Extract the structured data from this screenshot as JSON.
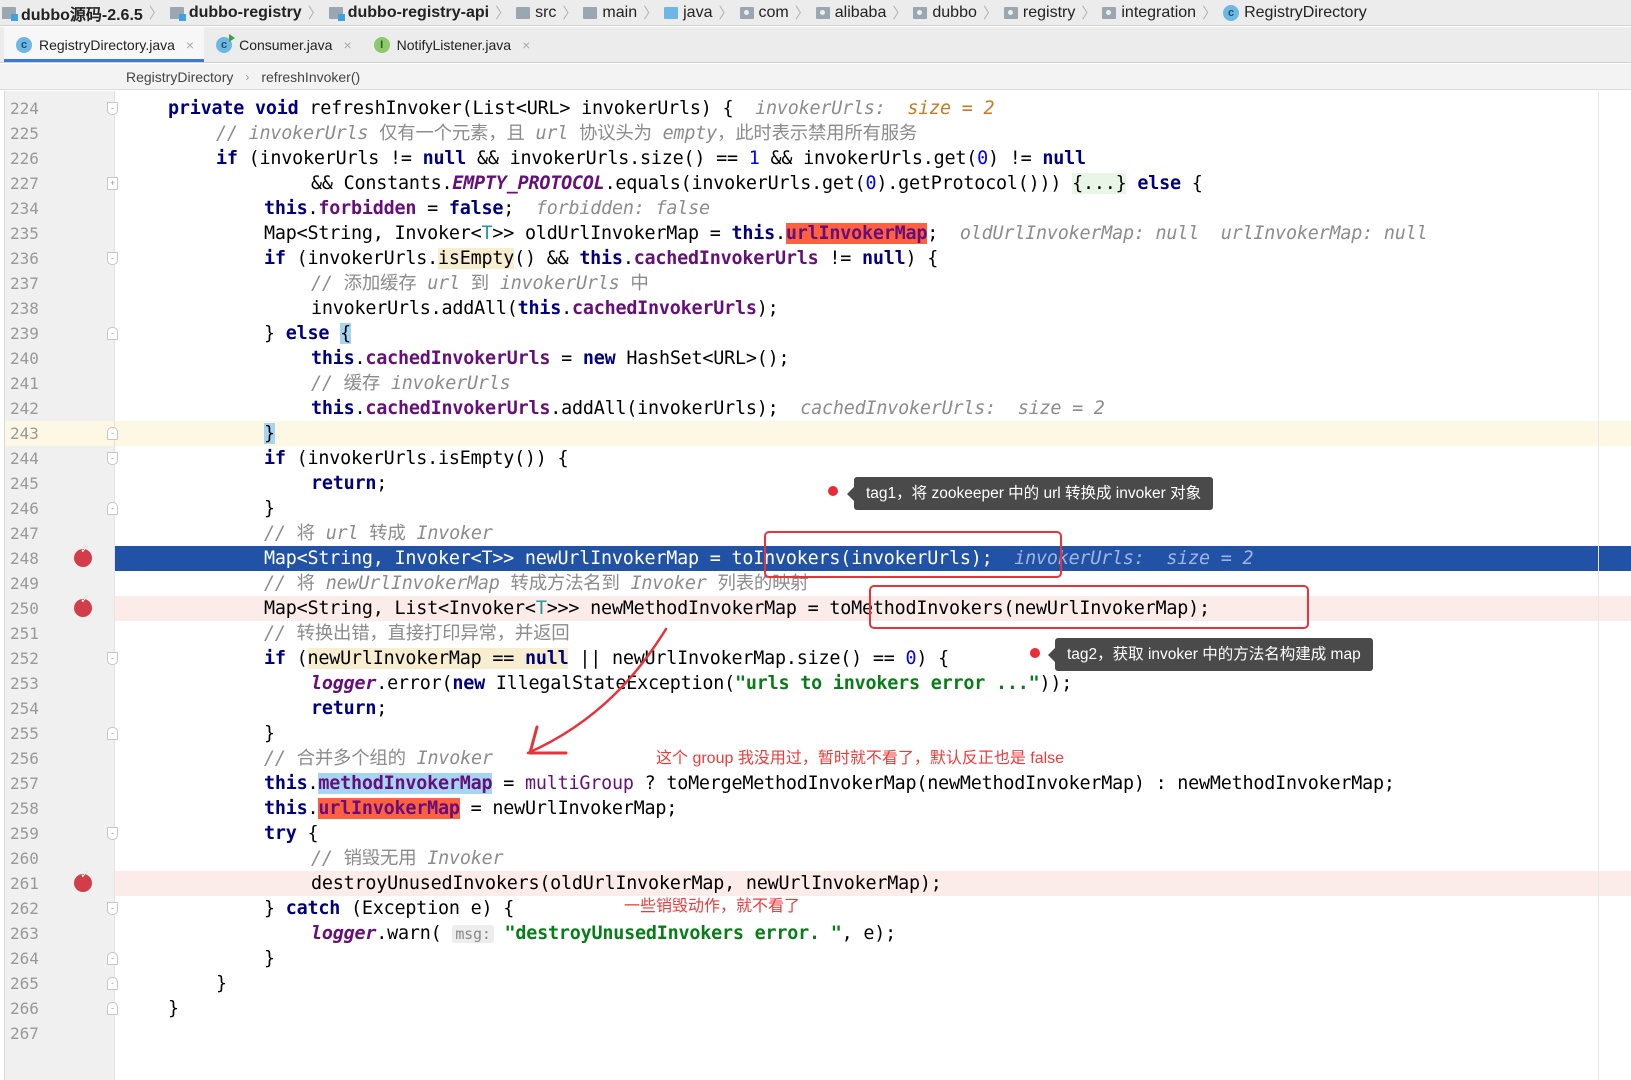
{
  "navbar": {
    "items": [
      {
        "label": "dubbo源码-2.6.5",
        "icon": "module-folder-icon"
      },
      {
        "label": "dubbo-registry",
        "icon": "module-folder-icon"
      },
      {
        "label": "dubbo-registry-api",
        "icon": "module-folder-icon"
      },
      {
        "label": "src",
        "icon": "folder-icon"
      },
      {
        "label": "main",
        "icon": "folder-icon"
      },
      {
        "label": "java",
        "icon": "source-folder-icon"
      },
      {
        "label": "com",
        "icon": "package-icon"
      },
      {
        "label": "alibaba",
        "icon": "package-icon"
      },
      {
        "label": "dubbo",
        "icon": "package-icon"
      },
      {
        "label": "registry",
        "icon": "package-icon"
      },
      {
        "label": "integration",
        "icon": "package-icon"
      },
      {
        "label": "RegistryDirectory",
        "icon": "class-icon"
      }
    ]
  },
  "tabs": [
    {
      "label": "RegistryDirectory.java",
      "icon": "C",
      "active": true
    },
    {
      "label": "Consumer.java",
      "icon": "C",
      "active": false
    },
    {
      "label": "NotifyListener.java",
      "icon": "I",
      "active": false
    }
  ],
  "code_breadcrumb": [
    "RegistryDirectory",
    "refreshInvoker()"
  ],
  "lines": [
    {
      "n": "224"
    },
    {
      "n": "225"
    },
    {
      "n": "226"
    },
    {
      "n": "227"
    },
    {
      "n": "234"
    },
    {
      "n": "235"
    },
    {
      "n": "236"
    },
    {
      "n": "237"
    },
    {
      "n": "238"
    },
    {
      "n": "239"
    },
    {
      "n": "240"
    },
    {
      "n": "241"
    },
    {
      "n": "242"
    },
    {
      "n": "243"
    },
    {
      "n": "244"
    },
    {
      "n": "245"
    },
    {
      "n": "246"
    },
    {
      "n": "247"
    },
    {
      "n": "248"
    },
    {
      "n": "249"
    },
    {
      "n": "250"
    },
    {
      "n": "251"
    },
    {
      "n": "252"
    },
    {
      "n": "253"
    },
    {
      "n": "254"
    },
    {
      "n": "255"
    },
    {
      "n": "256"
    },
    {
      "n": "257"
    },
    {
      "n": "258"
    },
    {
      "n": "259"
    },
    {
      "n": "260"
    },
    {
      "n": "261"
    },
    {
      "n": "262"
    },
    {
      "n": "263"
    },
    {
      "n": "264"
    },
    {
      "n": "265"
    },
    {
      "n": "266"
    },
    {
      "n": "267"
    }
  ],
  "code": {
    "l224": {
      "a": "private",
      "b": " ",
      "c": "void",
      "d": " refreshInvoker(List<URL> invokerUrls) {  ",
      "hint": "invokerUrls:  ",
      "hint2": "size = 2"
    },
    "l225": {
      "a": "// invokerUrls ",
      "b": "仅有一个元素，且 ",
      "c": "url ",
      "d": "协议头为 ",
      "e": "empty",
      "f": "，此时表示禁用所有服务"
    },
    "l226": {
      "a": "if",
      "b": " (invokerUrls != ",
      "c": "null",
      "d": " && invokerUrls.size() == ",
      "e": "1",
      "f": " && invokerUrls.get(",
      "g": "0",
      "h": ") != ",
      "i": "null"
    },
    "l227": {
      "a": "&& Constants.",
      "b": "EMPTY_PROTOCOL",
      "c": ".equals(invokerUrls.get(",
      "d": "0",
      "e": ").getProtocol())) ",
      "f": "{...}",
      "g": " ",
      "h": "else",
      "i": " {"
    },
    "l234": {
      "a": "this",
      "b": ".",
      "c": "forbidden",
      "d": " = ",
      "e": "false",
      "f": ";  ",
      "hint": "forbidden: false"
    },
    "l235": {
      "a": "Map<String, Invoker<",
      "b": "T",
      "c": ">> oldUrlInvokerMap = ",
      "d": "this",
      "e": ".",
      "f": "urlInvokerMap",
      "g": ";  ",
      "hint": "oldUrlInvokerMap: null  urlInvokerMap: null"
    },
    "l236": {
      "a": "if",
      "b": " (invokerUrls.",
      "c": "isEmpty",
      "d": "() && ",
      "e": "this",
      "f": ".",
      "g": "cachedInvokerUrls",
      "h": " != ",
      "i": "null",
      "j": ") {"
    },
    "l237": {
      "a": "// ",
      "b": "添加缓存 ",
      "c": "url ",
      "d": "到 ",
      "e": "invokerUrls ",
      "f": "中"
    },
    "l238": {
      "a": "invokerUrls.addAll(",
      "b": "this",
      "c": ".",
      "d": "cachedInvokerUrls",
      "e": ");"
    },
    "l239": {
      "a": "} ",
      "b": "else",
      "c": " ",
      "d": "{"
    },
    "l240": {
      "a": "this",
      "b": ".",
      "c": "cachedInvokerUrls",
      "d": " = ",
      "e": "new",
      "f": " HashSet<URL>();"
    },
    "l241": {
      "a": "// ",
      "b": "缓存 ",
      "c": "invokerUrls"
    },
    "l242": {
      "a": "this",
      "b": ".",
      "c": "cachedInvokerUrls",
      "d": ".addAll(invokerUrls);  ",
      "hint": "cachedInvokerUrls:  size = 2"
    },
    "l243": {
      "a": "}"
    },
    "l244": {
      "a": "if",
      "b": " (invokerUrls.isEmpty()) {"
    },
    "l245": {
      "a": "return",
      "b": ";"
    },
    "l246": {
      "a": "}"
    },
    "l247": {
      "a": "// ",
      "b": "将 ",
      "c": "url ",
      "d": "转成 ",
      "e": "Invoker"
    },
    "l248": {
      "a": "Map<String, Invoker<T>> newUrlInvokerMap = ",
      "b": "toInvokers(invokerUrls);",
      "c": "  ",
      "hint": "invokerUrls:  size = 2"
    },
    "l249": {
      "a": "// ",
      "b": "将 ",
      "c": "newUrlInvokerMap ",
      "d": "转成方法名到 ",
      "e": "Invoker ",
      "f": "列表的映射"
    },
    "l250": {
      "a": "Map<String, List<Invoker<",
      "b": "T",
      "c": ">>> newMethodInvokerMap = ",
      "d": "toMethodInvokers(newUrlInvokerMap);"
    },
    "l251": {
      "a": "// ",
      "b": "转换出错，直接打印异常，并返回"
    },
    "l252": {
      "a": "if",
      "b": " (",
      "c": "newUrlInvokerMap == ",
      "d": "null",
      "e": " || newUrlInvokerMap.size() == ",
      "f": "0",
      "g": ") {"
    },
    "l253": {
      "a": "logger",
      "b": ".error(",
      "c": "new",
      "d": " IllegalStateException(",
      "e": "\"urls to invokers error ...\"",
      "f": "));"
    },
    "l254": {
      "a": "return",
      "b": ";"
    },
    "l255": {
      "a": "}"
    },
    "l256": {
      "a": "// ",
      "b": "合并多个组的 ",
      "c": "Invoker"
    },
    "l257": {
      "a": "this",
      "b": ".",
      "c": "methodInvokerMap",
      "d": " = ",
      "e": "multiGroup",
      "f": " ? toMergeMethodInvokerMap(newMethodInvokerMap) : newMethodInvokerMap;"
    },
    "l258": {
      "a": "this",
      "b": ".",
      "c": "urlInvokerMap",
      "d": " = newUrlInvokerMap;"
    },
    "l259": {
      "a": "try",
      "b": " {"
    },
    "l260": {
      "a": "// ",
      "b": "销毁无用 ",
      "c": "Invoker"
    },
    "l261": {
      "a": "destroyUnusedInvokers(oldUrlInvokerMap, newUrlInvokerMap);"
    },
    "l262": {
      "a": "} ",
      "b": "catch",
      "c": " (Exception e) {"
    },
    "l263": {
      "a": "logger",
      "b": ".warn( ",
      "hint": "msg:",
      "c": " ",
      "d": "\"destroyUnusedInvokers error. \"",
      "e": ", e);"
    },
    "l264": {
      "a": "}"
    },
    "l265": {
      "a": "}"
    },
    "l266": {
      "a": "}"
    }
  },
  "annotations": {
    "tag1": "tag1，将 zookeeper 中的 url 转换成 invoker 对象",
    "tag2": "tag2，获取 invoker 中的方法名构建成 map",
    "note_group": "这个 group 我没用过，暂时就不看了，默认反正也是 false",
    "note_destroy": "一些销毁动作，就不看了"
  },
  "colors": {
    "execution_line": "#2252a6",
    "breakpoint": "#d33d4a",
    "annotation_red": "#e8323c",
    "tooltip_bg": "#4a4a4a"
  }
}
